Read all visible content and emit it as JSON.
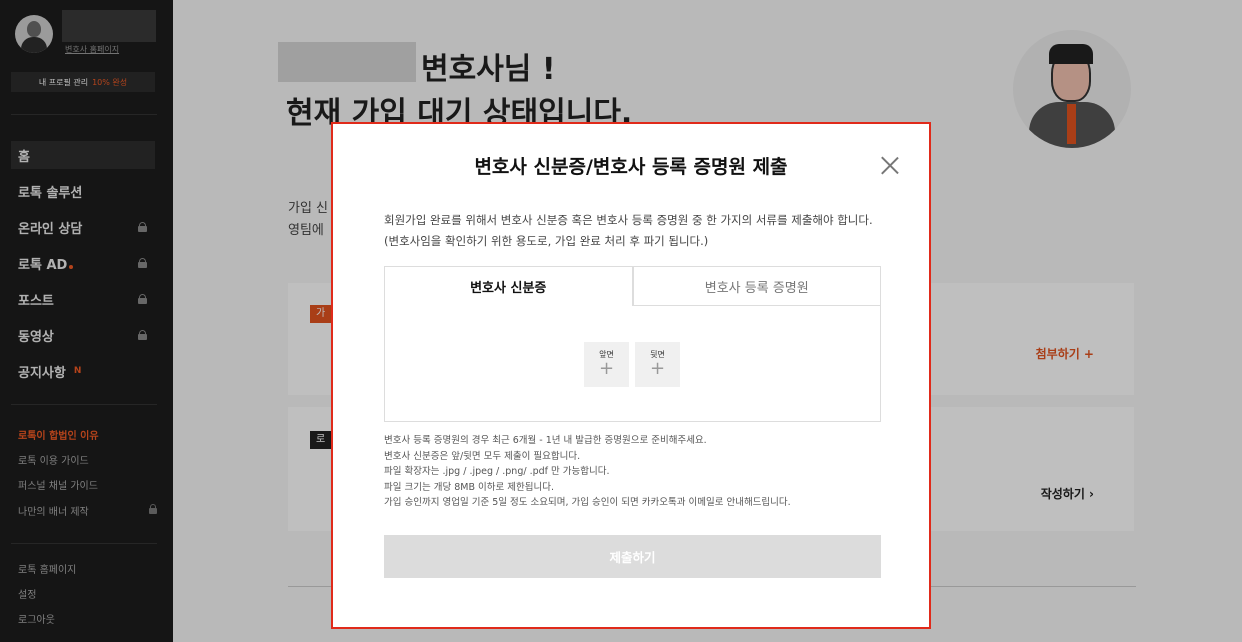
{
  "sidebar": {
    "homepage_link": "변호사 홈페이지",
    "profile_label": "내 프로필 관리",
    "profile_pct": "10% 완성",
    "nav": [
      {
        "label": "홈"
      },
      {
        "label": "로톡 솔루션"
      },
      {
        "label": "온라인 상담"
      },
      {
        "label": "로톡 AD"
      },
      {
        "label": "포스트"
      },
      {
        "label": "동영상"
      },
      {
        "label": "공지사항",
        "badge": "N"
      }
    ],
    "sub1": [
      "로톡이 합법인 이유",
      "로톡 이용 가이드",
      "퍼스널 채널 가이드",
      "나만의 배너 제작"
    ],
    "sub2": [
      "로톡 홈페이지",
      "설정",
      "로그아웃"
    ]
  },
  "main": {
    "greeting_line1": "변호사님 !",
    "greeting_line2": "현재 가입 대기 상태입니다.",
    "join_text_1": "가입 신",
    "join_text_2": "영팀에",
    "card1_tag": "가",
    "card1_action": "첨부하기 +",
    "card2_tag": "로",
    "card2_action": "작성하기 ›"
  },
  "modal": {
    "title": "변호사 신분증/변호사 등록 증명원 제출",
    "desc1": "회원가입 완료를 위해서 변호사 신분증 혹은 변호사 등록 증명원 중 한 가지의 서류를 제출해야 합니다.",
    "desc2": "(변호사임을 확인하기 위한 용도로, 가입 완료 처리 후 파기 됩니다.)",
    "tab_active": "변호사 신분증",
    "tab_inactive": "변호사 등록 증명원",
    "front_label": "앞면",
    "back_label": "뒷면",
    "plus": "+",
    "notes": [
      "변호사 등록 증명원의 경우 최근 6개월 - 1년 내 발급한 증명원으로 준비해주세요.",
      "변호사 신분증은 앞/뒷면 모두 제출이 필요합니다.",
      "파일 확장자는 .jpg / .jpeg / .png/ .pdf 만 가능합니다.",
      "파일 크기는 개당 8MB 이하로 제한됩니다.",
      "가입 승인까지 영업일 기준 5일 정도 소요되며, 가입 승인이 되면 카카오톡과 이메일로 안내해드립니다."
    ],
    "submit_label": "제출하기"
  },
  "colors": {
    "accent": "#f15a24",
    "modal_border": "#e02a1a",
    "sidebar_bg": "#1c1c1c"
  }
}
